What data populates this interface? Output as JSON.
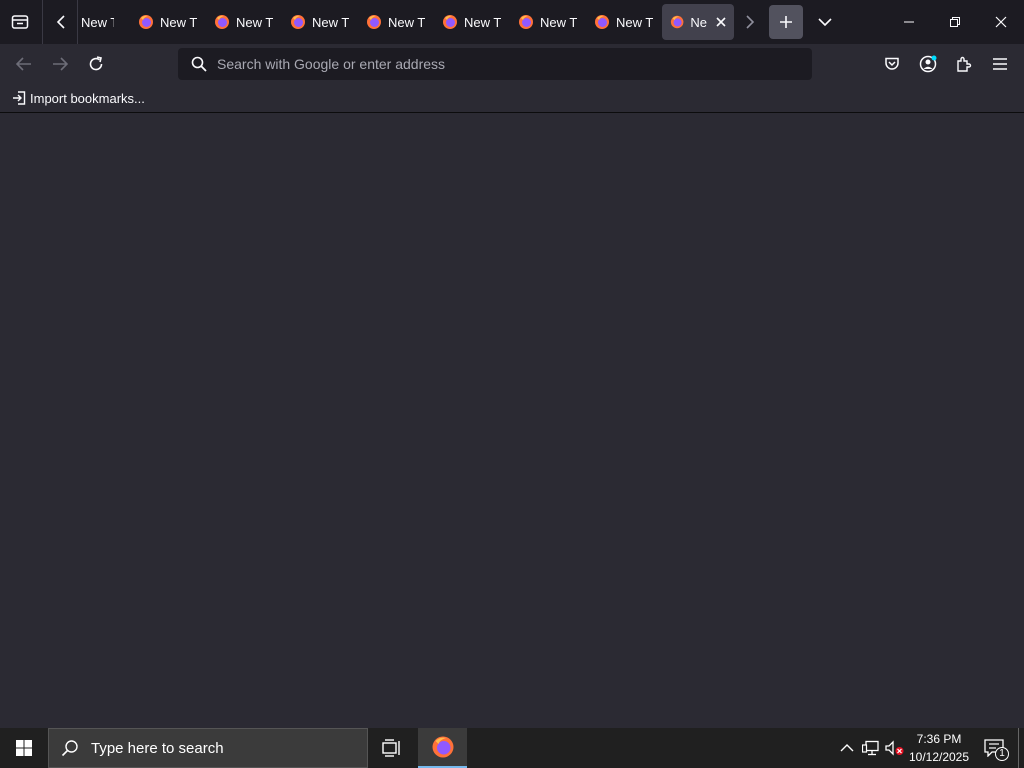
{
  "tabs": {
    "items": [
      {
        "label": "New T",
        "active": false
      },
      {
        "label": "New T",
        "active": false
      },
      {
        "label": "New T",
        "active": false
      },
      {
        "label": "New T",
        "active": false
      },
      {
        "label": "New T",
        "active": false
      },
      {
        "label": "New T",
        "active": false
      },
      {
        "label": "New T",
        "active": false
      },
      {
        "label": "New T",
        "active": false
      },
      {
        "label": "Ne",
        "active": true
      }
    ]
  },
  "urlbar": {
    "placeholder": "Search with Google or enter address"
  },
  "bookmarks": {
    "import_label": "Import bookmarks..."
  },
  "taskbar": {
    "search_placeholder": "Type here to search",
    "time": "7:36 PM",
    "date": "10/12/2025",
    "notification_count": "1"
  },
  "colors": {
    "accent": "#00ddff",
    "taskbar_highlight": "#76b9ed"
  }
}
